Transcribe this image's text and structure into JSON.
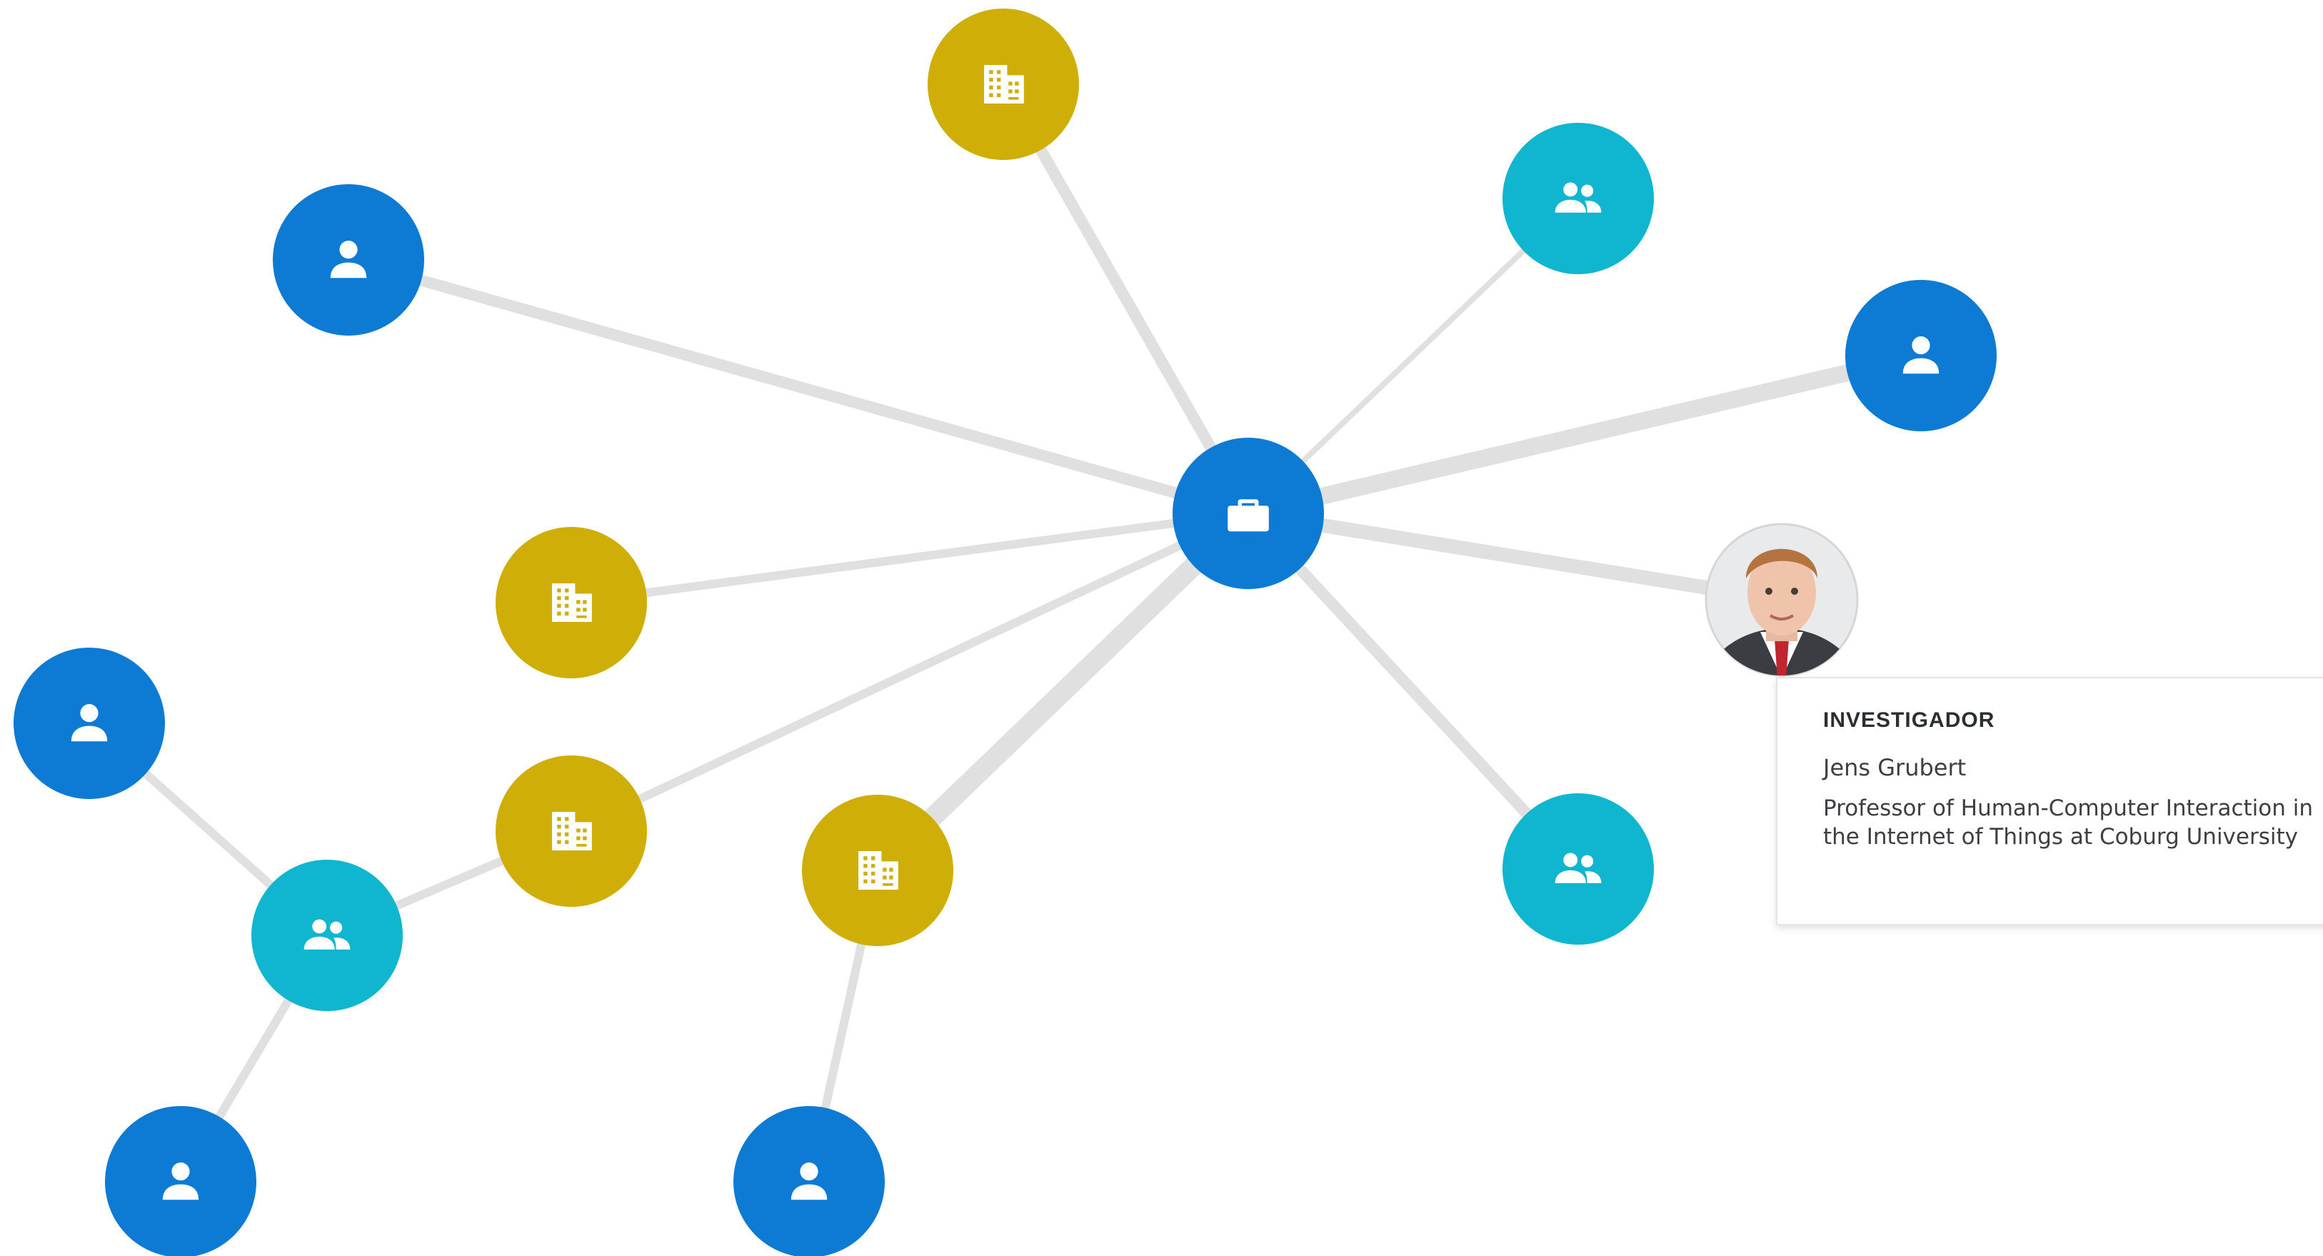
{
  "colors": {
    "person": "#0d7ad4",
    "project": "#0d7ad4",
    "organization": "#cfae08",
    "group": "#10b5d0",
    "edge": "#e0e0e0"
  },
  "nodes": [
    {
      "id": "project-center",
      "type": "project",
      "icon": "briefcase-icon"
    },
    {
      "id": "org-top",
      "type": "organization",
      "icon": "building-icon"
    },
    {
      "id": "person-topleft",
      "type": "person",
      "icon": "person-icon"
    },
    {
      "id": "group-topright",
      "type": "group",
      "icon": "people-icon"
    },
    {
      "id": "person-right",
      "type": "person",
      "icon": "person-icon"
    },
    {
      "id": "person-photo",
      "type": "person",
      "icon": "photo-avatar"
    },
    {
      "id": "org-midleft",
      "type": "organization",
      "icon": "building-icon"
    },
    {
      "id": "person-left",
      "type": "person",
      "icon": "person-icon"
    },
    {
      "id": "org-left2",
      "type": "organization",
      "icon": "building-icon"
    },
    {
      "id": "group-left",
      "type": "group",
      "icon": "people-icon"
    },
    {
      "id": "org-bottom",
      "type": "organization",
      "icon": "building-icon"
    },
    {
      "id": "group-bottomright",
      "type": "group",
      "icon": "people-icon"
    },
    {
      "id": "person-bottomleft",
      "type": "person",
      "icon": "person-icon"
    },
    {
      "id": "person-bottom",
      "type": "person",
      "icon": "person-icon"
    }
  ],
  "edges": [
    {
      "from": "project-center",
      "to": "org-top",
      "weight": 3
    },
    {
      "from": "project-center",
      "to": "person-topleft",
      "weight": 3
    },
    {
      "from": "project-center",
      "to": "group-topright",
      "weight": 1
    },
    {
      "from": "project-center",
      "to": "person-right",
      "weight": 5
    },
    {
      "from": "project-center",
      "to": "person-photo",
      "weight": 4
    },
    {
      "from": "project-center",
      "to": "org-midleft",
      "weight": 2
    },
    {
      "from": "project-center",
      "to": "org-left2",
      "weight": 2
    },
    {
      "from": "project-center",
      "to": "org-bottom",
      "weight": 6
    },
    {
      "from": "project-center",
      "to": "group-bottomright",
      "weight": 3
    },
    {
      "from": "person-left",
      "to": "group-left",
      "weight": 2
    },
    {
      "from": "org-left2",
      "to": "group-left",
      "weight": 2
    },
    {
      "from": "group-left",
      "to": "person-bottomleft",
      "weight": 2
    },
    {
      "from": "org-bottom",
      "to": "person-bottom",
      "weight": 2
    }
  ],
  "tooltip": {
    "role": "INVESTIGADOR",
    "name": "Jens Grubert",
    "description": "Professor of Human-Computer Interaction in the Internet of Things at Coburg University"
  }
}
